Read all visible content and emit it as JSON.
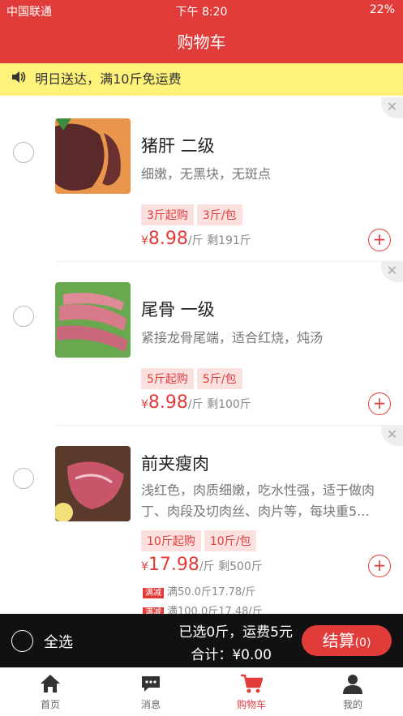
{
  "status": {
    "carrier": "中国联通",
    "time": "下午 8:20",
    "battery": "22%"
  },
  "header": {
    "title": "购物车"
  },
  "notice": {
    "text": "明日送达，满10斤免运费"
  },
  "items": [
    {
      "name": "猪肝 二级",
      "desc": "细嫩，无黑块，无斑点",
      "tags": [
        "3斤起购",
        "3斤/包"
      ],
      "currency": "¥",
      "price": "8.98",
      "unit": "/斤",
      "stock": "剩191斤"
    },
    {
      "name": "尾骨 一级",
      "desc": "紧接龙骨尾端，适合红烧，炖汤",
      "tags": [
        "5斤起购",
        "5斤/包"
      ],
      "currency": "¥",
      "price": "8.98",
      "unit": "/斤",
      "stock": "剩100斤"
    },
    {
      "name": "前夹瘦肉",
      "desc": "浅红色，肉质细嫩，吃水性强，适于做肉丁、肉段及切肉丝、肉片等，每块重5...",
      "tags": [
        "10斤起购",
        "10斤/包"
      ],
      "currency": "¥",
      "price": "17.98",
      "unit": "/斤",
      "stock": "剩500斤",
      "promos": [
        {
          "badge": "满减",
          "text": "满50.0斤17.78/斤"
        },
        {
          "badge": "满减",
          "text": "满100.0斤17.48/斤"
        }
      ]
    }
  ],
  "bottom": {
    "select_all": "全选",
    "selected": "已选0斤，运费5元",
    "total": "合计：¥0.00",
    "checkout": "结算",
    "checkout_count": "(0)"
  },
  "tabs": [
    {
      "label": "首页"
    },
    {
      "label": "消息"
    },
    {
      "label": "购物车"
    },
    {
      "label": "我的"
    }
  ],
  "colors": {
    "primary": "#e23c3a",
    "notice_bg": "#fff27a"
  }
}
